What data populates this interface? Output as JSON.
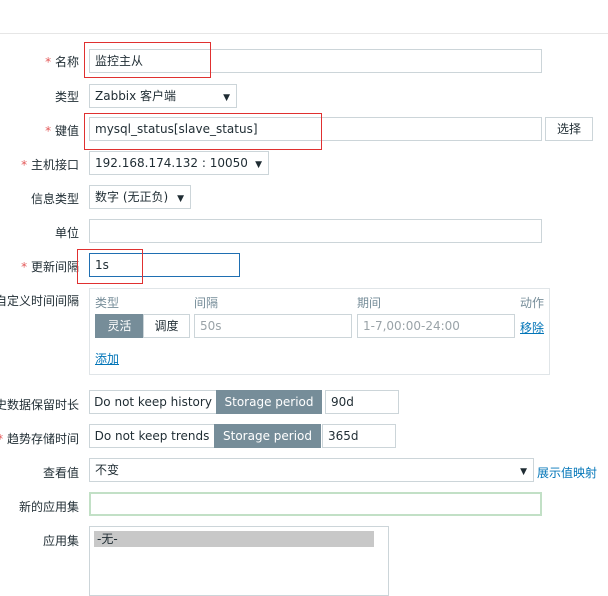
{
  "form": {
    "name": {
      "label": "名称",
      "value": "监控主从"
    },
    "type": {
      "label": "类型",
      "value": "Zabbix 客户端"
    },
    "key": {
      "label": "键值",
      "value": "mysql_status[slave_status]",
      "select_button": "选择"
    },
    "interface": {
      "label": "主机接口",
      "value": "192.168.174.132 : 10050"
    },
    "info_type": {
      "label": "信息类型",
      "value": "数字 (无正负)"
    },
    "units": {
      "label": "单位",
      "value": ""
    },
    "interval": {
      "label": "更新间隔",
      "value": "1s"
    },
    "custom_intervals": {
      "label": "自定义时间间隔",
      "headers": {
        "type": "类型",
        "interval": "间隔",
        "period": "期间",
        "action": "动作"
      },
      "toggle": {
        "flexible": "灵活",
        "scheduling": "调度"
      },
      "interval_placeholder": "50s",
      "period_placeholder": "1-7,00:00-24:00",
      "remove": "移除",
      "add": "添加"
    },
    "history": {
      "label": "历史数据保留时长",
      "no_keep": "Do not keep history",
      "storage": "Storage period",
      "value": "90d"
    },
    "trends": {
      "label": "趋势存储时间",
      "no_keep": "Do not keep trends",
      "storage": "Storage period",
      "value": "365d"
    },
    "show_value": {
      "label": "查看值",
      "value": "不变",
      "link": "展示值映射"
    },
    "new_app": {
      "label": "新的应用集",
      "value": ""
    },
    "apps": {
      "label": "应用集",
      "items": [
        "-无-"
      ]
    }
  },
  "colors": {
    "accent_blue": "#0275b8",
    "active_toggle": "#768d99",
    "required": "#e45959",
    "annotation": "#e03030"
  }
}
